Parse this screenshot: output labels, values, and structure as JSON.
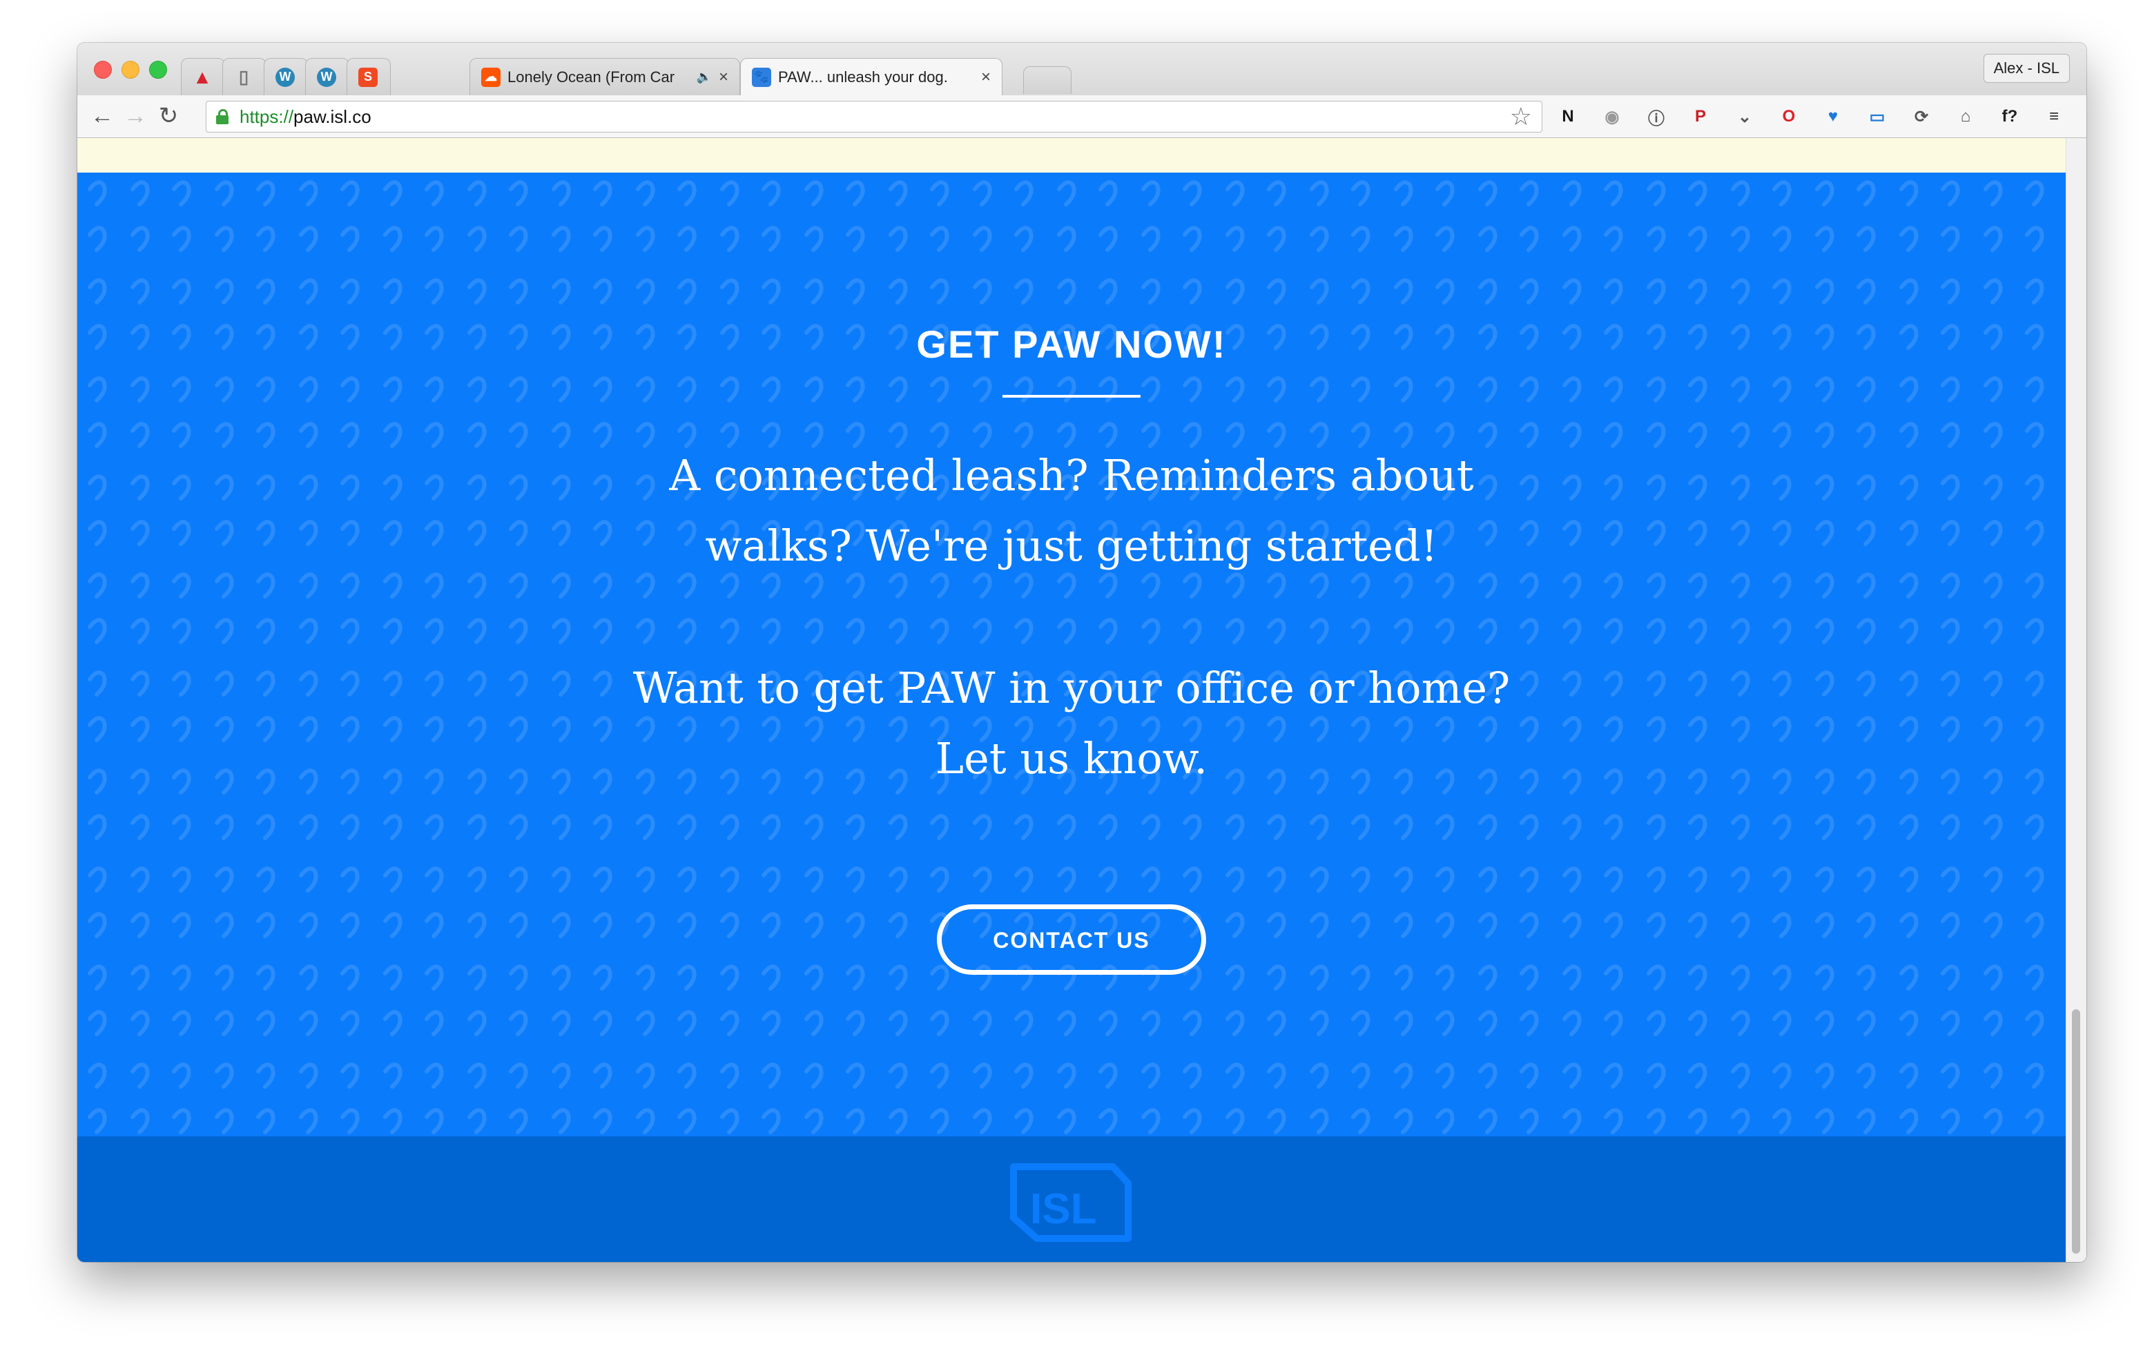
{
  "browser": {
    "tabs": [
      {
        "title": "",
        "icon": "warning-triangle-icon",
        "color": "#d6232f"
      },
      {
        "title": "",
        "icon": "blank-page-icon",
        "color": "#777777"
      },
      {
        "title": "",
        "icon": "wordpress-icon",
        "color": "#2b86b8"
      },
      {
        "title": "",
        "icon": "wordpress-icon",
        "color": "#2b86b8"
      },
      {
        "title": "",
        "icon": "simplenote-s-icon",
        "color": "#f04a23"
      },
      {
        "title": "Lonely Ocean (From Car",
        "icon": "soundcloud-icon",
        "color": "#ff5500",
        "audio": "🔈",
        "close": "×"
      },
      {
        "title": "PAW... unleash your dog.",
        "icon": "paw-site-icon",
        "color": "#2f7fe0",
        "close": "×",
        "active": true
      }
    ],
    "profile_name": "Alex - ISL",
    "url_scheme": "https://",
    "url_host": "paw.isl.co",
    "nav": {
      "back": "←",
      "forward": "→",
      "reload": "↻"
    },
    "star": "☆",
    "extensions": [
      {
        "name": "evernote-n-icon",
        "glyph": "N",
        "color": "#1a1a1a"
      },
      {
        "name": "camera-icon",
        "glyph": "◉",
        "color": "#999999"
      },
      {
        "name": "onepassword-icon",
        "glyph": "ⓘ",
        "color": "#555555"
      },
      {
        "name": "pinterest-icon",
        "glyph": "P",
        "color": "#cb2027"
      },
      {
        "name": "pocket-icon",
        "glyph": "⌄",
        "color": "#555555"
      },
      {
        "name": "opera-icon",
        "glyph": "O",
        "color": "#e0202b"
      },
      {
        "name": "heart-extension-icon",
        "glyph": "♥",
        "color": "#1e7ad9"
      },
      {
        "name": "screen-capture-icon",
        "glyph": "▭",
        "color": "#1e7ad9"
      },
      {
        "name": "sync-icon",
        "glyph": "⟳",
        "color": "#555555"
      },
      {
        "name": "cast-icon",
        "glyph": "⌂",
        "color": "#555555"
      },
      {
        "name": "font-question-icon",
        "glyph": "f?",
        "color": "#222222"
      },
      {
        "name": "menu-icon",
        "glyph": "≡",
        "color": "#333333"
      }
    ]
  },
  "page": {
    "hero_title": "GET PAW NOW!",
    "copy_line_1": "A connected leash? Reminders about",
    "copy_line_2": "walks? We're just getting started!",
    "copy_line_3": "Want to get PAW in your office or home?",
    "copy_line_4": "Let us know.",
    "cta_label": "CONTACT US",
    "footer_logo": "ISL",
    "colors": {
      "hero_bg": "#0a7bfb",
      "footer_bg": "#0065d1",
      "notice_strip": "#fcfbe2"
    }
  }
}
